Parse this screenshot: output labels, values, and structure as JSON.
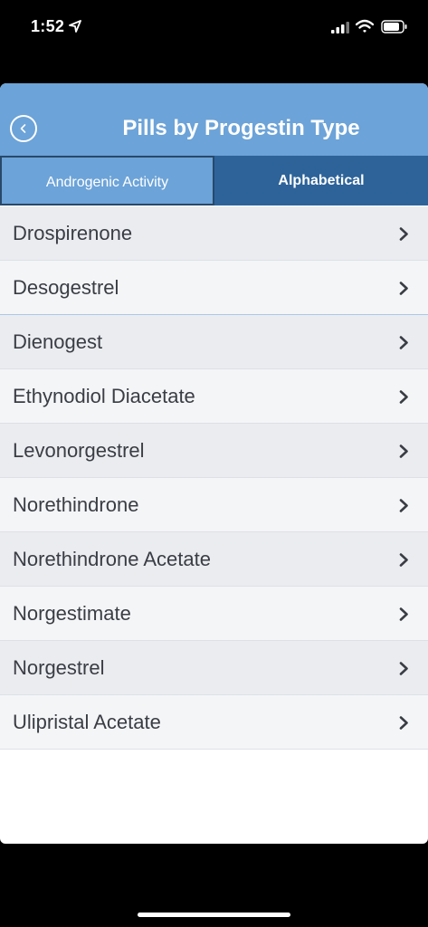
{
  "status_bar": {
    "time": "1:52"
  },
  "nav": {
    "title": "Pills by Progestin Type"
  },
  "segments": [
    {
      "label": "Androgenic Activity",
      "selected": true
    },
    {
      "label": "Alphabetical",
      "selected": false
    }
  ],
  "list": {
    "items": [
      {
        "label": "Drospirenone"
      },
      {
        "label": "Desogestrel"
      },
      {
        "label": "Dienogest"
      },
      {
        "label": "Ethynodiol Diacetate"
      },
      {
        "label": "Levonorgestrel"
      },
      {
        "label": "Norethindrone"
      },
      {
        "label": "Norethindrone Acetate"
      },
      {
        "label": "Norgestimate"
      },
      {
        "label": "Norgestrel"
      },
      {
        "label": "Ulipristal Acetate"
      }
    ]
  },
  "colors": {
    "nav_bar": "#6ca3d8",
    "segment_dark": "#2d6399",
    "row_odd": "#ebecf0",
    "row_even": "#f4f5f7",
    "text": "#3a3d44"
  },
  "icons": [
    "location-arrow-icon",
    "cellular-signal-icon",
    "wifi-icon",
    "battery-icon",
    "back-chevron-icon",
    "chevron-right-icon"
  ]
}
